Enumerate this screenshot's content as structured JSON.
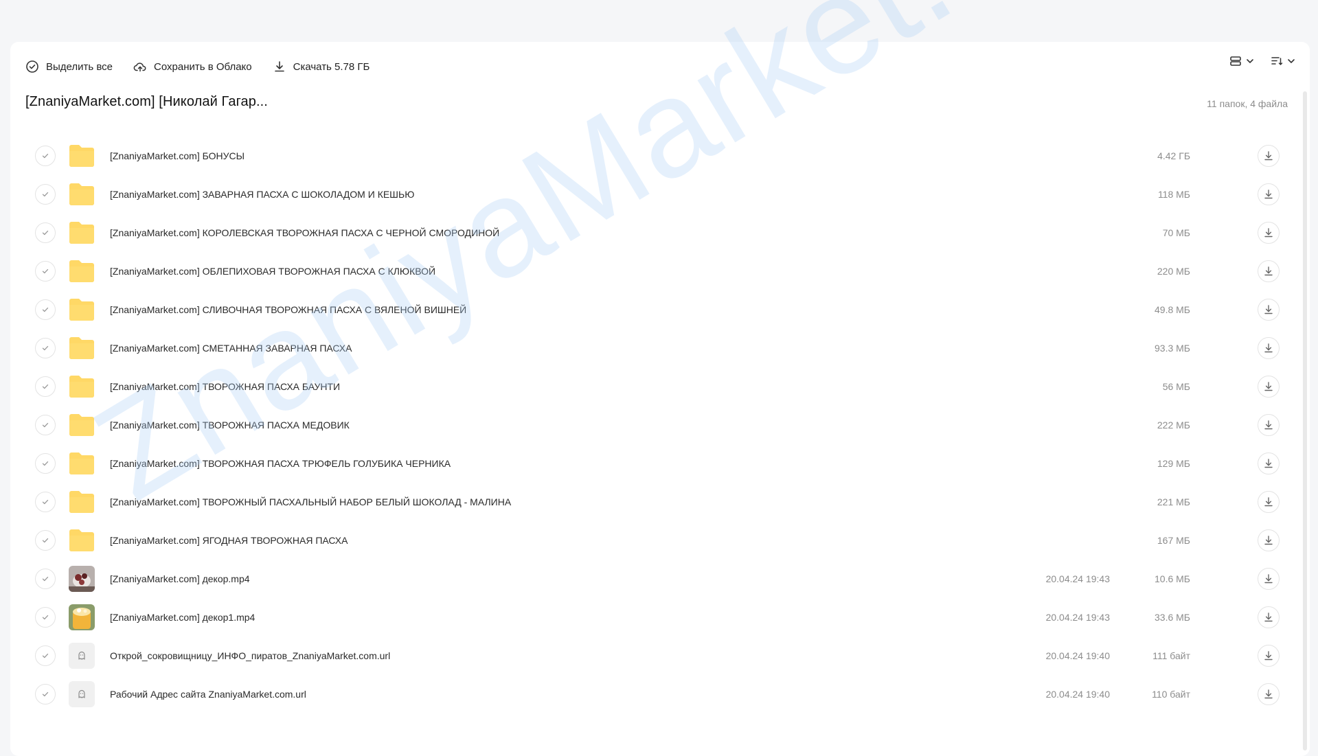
{
  "toolbar": {
    "select_all": "Выделить все",
    "save_cloud": "Сохранить в Облако",
    "download": "Скачать 5.78 ГБ"
  },
  "folder": {
    "title": "[ZnaniyaMarket.com] [Николай Гагар...",
    "summary": "11 папок, 4 файла"
  },
  "watermark": "ZnaniyaMarket.club",
  "items": [
    {
      "name": "[ZnaniyaMarket.com] БОНУСЫ",
      "date": "",
      "size": "4.42 ГБ",
      "type": "folder"
    },
    {
      "name": "[ZnaniyaMarket.com] ЗАВАРНАЯ ПАСХА С ШОКОЛАДОМ И КЕШЬЮ",
      "date": "",
      "size": "118 МБ",
      "type": "folder"
    },
    {
      "name": "[ZnaniyaMarket.com] КОРОЛЕВСКАЯ ТВОРОЖНАЯ ПАСХА С ЧЕРНОЙ СМОРОДИНОЙ",
      "date": "",
      "size": "70 МБ",
      "type": "folder"
    },
    {
      "name": "[ZnaniyaMarket.com] ОБЛЕПИХОВАЯ ТВОРОЖНАЯ ПАСХА С КЛЮКВОЙ",
      "date": "",
      "size": "220 МБ",
      "type": "folder"
    },
    {
      "name": "[ZnaniyaMarket.com] СЛИВОЧНАЯ ТВОРОЖНАЯ ПАСХА С ВЯЛЕНОЙ ВИШНЕЙ",
      "date": "",
      "size": "49.8 МБ",
      "type": "folder"
    },
    {
      "name": "[ZnaniyaMarket.com] СМЕТАННАЯ ЗАВАРНАЯ ПАСХА",
      "date": "",
      "size": "93.3 МБ",
      "type": "folder"
    },
    {
      "name": "[ZnaniyaMarket.com] ТВОРОЖНАЯ ПАСХА БАУНТИ",
      "date": "",
      "size": "56 МБ",
      "type": "folder"
    },
    {
      "name": "[ZnaniyaMarket.com] ТВОРОЖНАЯ ПАСХА МЕДОВИК",
      "date": "",
      "size": "222 МБ",
      "type": "folder"
    },
    {
      "name": "[ZnaniyaMarket.com] ТВОРОЖНАЯ ПАСХА ТРЮФЕЛЬ ГОЛУБИКА ЧЕРНИКА",
      "date": "",
      "size": "129 МБ",
      "type": "folder"
    },
    {
      "name": "[ZnaniyaMarket.com] ТВОРОЖНЫЙ ПАСХАЛЬНЫЙ НАБОР БЕЛЫЙ ШОКОЛАД - МАЛИНА",
      "date": "",
      "size": "221 МБ",
      "type": "folder"
    },
    {
      "name": "[ZnaniyaMarket.com] ЯГОДНАЯ ТВОРОЖНАЯ ПАСХА",
      "date": "",
      "size": "167 МБ",
      "type": "folder"
    },
    {
      "name": "[ZnaniyaMarket.com] декор.mp4",
      "date": "20.04.24 19:43",
      "size": "10.6 МБ",
      "type": "video1"
    },
    {
      "name": "[ZnaniyaMarket.com] декор1.mp4",
      "date": "20.04.24 19:43",
      "size": "33.6 МБ",
      "type": "video2"
    },
    {
      "name": "Открой_сокровищницу_ИНФО_пиратов_ZnaniyaMarket.com.url",
      "date": "20.04.24 19:40",
      "size": "111 байт",
      "type": "url"
    },
    {
      "name": "Рабочий Адрес сайта ZnaniyaMarket.com.url",
      "date": "20.04.24 19:40",
      "size": "110 байт",
      "type": "url"
    }
  ]
}
